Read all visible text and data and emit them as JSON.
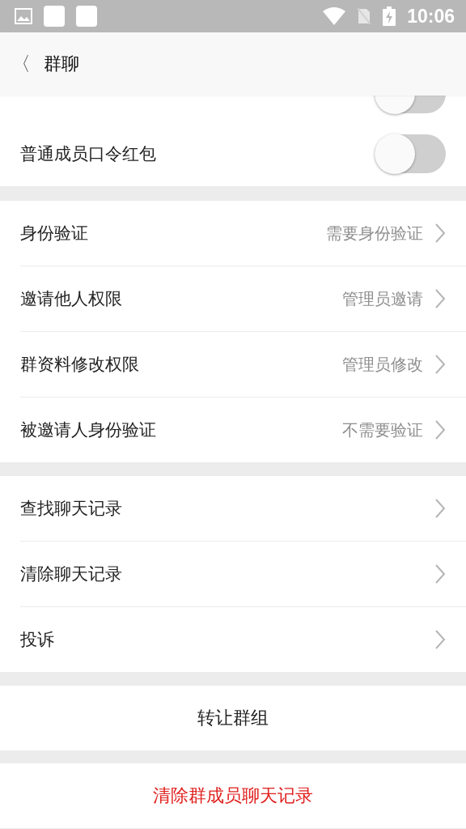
{
  "status_bar": {
    "time": "10:06"
  },
  "header": {
    "back": "〈",
    "title": "群聊"
  },
  "toggle_rows": [
    {
      "on": false
    },
    {
      "label": "普通成员口令红包",
      "on": false
    }
  ],
  "permission_rows": [
    {
      "label": "身份验证",
      "value": "需要身份验证"
    },
    {
      "label": "邀请他人权限",
      "value": "管理员邀请"
    },
    {
      "label": "群资料修改权限",
      "value": "管理员修改"
    },
    {
      "label": "被邀请人身份验证",
      "value": "不需要验证"
    }
  ],
  "record_rows": [
    {
      "label": "查找聊天记录"
    },
    {
      "label": "清除聊天记录"
    },
    {
      "label": "投诉"
    }
  ],
  "buttons": [
    {
      "label": "转让群组",
      "kind": "normal"
    },
    {
      "label": "清除群成员聊天记录",
      "kind": "danger"
    }
  ]
}
